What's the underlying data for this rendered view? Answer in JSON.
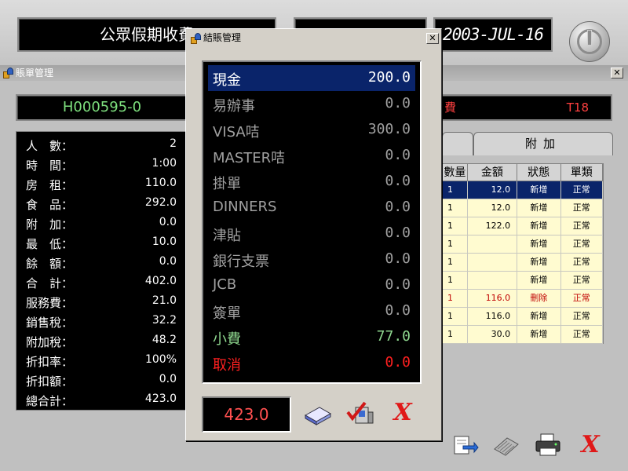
{
  "top": {
    "title": "公眾假期收費",
    "date": "2003-JUL-16",
    "power_icon": "power-icon"
  },
  "back_window": {
    "title": "賬單管理",
    "bill_id": "H000595-0",
    "table_label": "費",
    "table_no": "T18",
    "summary": [
      {
        "label": "人　數：",
        "value": "2"
      },
      {
        "label": "時　間：",
        "value": "1:00"
      },
      {
        "label": "房　租：",
        "value": "110.0"
      },
      {
        "label": "食　品：",
        "value": "292.0"
      },
      {
        "label": "附　加：",
        "value": "0.0"
      },
      {
        "label": "最　低：",
        "value": "10.0"
      },
      {
        "label": "餘　額：",
        "value": "0.0"
      },
      {
        "label": "合　計：",
        "value": "402.0"
      },
      {
        "label": "服務費：",
        "value": "21.0"
      },
      {
        "label": "銷售稅：",
        "value": "32.2"
      },
      {
        "label": "附加稅：",
        "value": "48.2"
      },
      {
        "label": "折扣率：",
        "value": "100%"
      },
      {
        "label": "折扣額：",
        "value": "0.0"
      },
      {
        "label": "總合計：",
        "value": "423.0"
      }
    ],
    "tab_extra": "附加",
    "grid_headers": [
      "數量",
      "金額",
      "狀態",
      "單類"
    ],
    "grid_rows": [
      {
        "qty": "1",
        "amount": "12.0",
        "status": "新增",
        "type": "正常"
      },
      {
        "qty": "1",
        "amount": "12.0",
        "status": "新增",
        "type": "正常"
      },
      {
        "qty": "1",
        "amount": "122.0",
        "status": "新增",
        "type": "正常"
      },
      {
        "qty": "1",
        "amount": "",
        "status": "新增",
        "type": "正常"
      },
      {
        "qty": "1",
        "amount": "",
        "status": "新增",
        "type": "正常"
      },
      {
        "qty": "1",
        "amount": "",
        "status": "新增",
        "type": "正常"
      },
      {
        "qty": "1",
        "amount": "116.0",
        "status": "刪除",
        "type": "正常"
      },
      {
        "qty": "1",
        "amount": "116.0",
        "status": "新增",
        "type": "正常"
      },
      {
        "qty": "1",
        "amount": "30.0",
        "status": "新增",
        "type": "正常"
      }
    ],
    "toolbar_icons": [
      "export-icon",
      "keyboard-icon",
      "printer-icon",
      "cancel-icon"
    ]
  },
  "dialog": {
    "title": "結賬管理",
    "payments": [
      {
        "label": "現金",
        "value": "200.0"
      },
      {
        "label": "易辦事",
        "value": "0.0"
      },
      {
        "label": "VISA咭",
        "value": "300.0"
      },
      {
        "label": "MASTER咭",
        "value": "0.0"
      },
      {
        "label": "掛單",
        "value": "0.0"
      },
      {
        "label": "DINNERS",
        "value": "0.0"
      },
      {
        "label": "津貼",
        "value": "0.0"
      },
      {
        "label": "銀行支票",
        "value": "0.0"
      },
      {
        "label": "JCB",
        "value": "0.0"
      },
      {
        "label": "簽單",
        "value": "0.0"
      },
      {
        "label": "小費",
        "value": "77.0"
      },
      {
        "label": "取消",
        "value": "0.0"
      }
    ],
    "total": "423.0",
    "cancel_mark": "X"
  },
  "colors": {
    "selection": "#0a246a",
    "lcd_green": "#7ee07e",
    "lcd_red": "#ff4040",
    "grid_bg": "#fffbd0"
  }
}
